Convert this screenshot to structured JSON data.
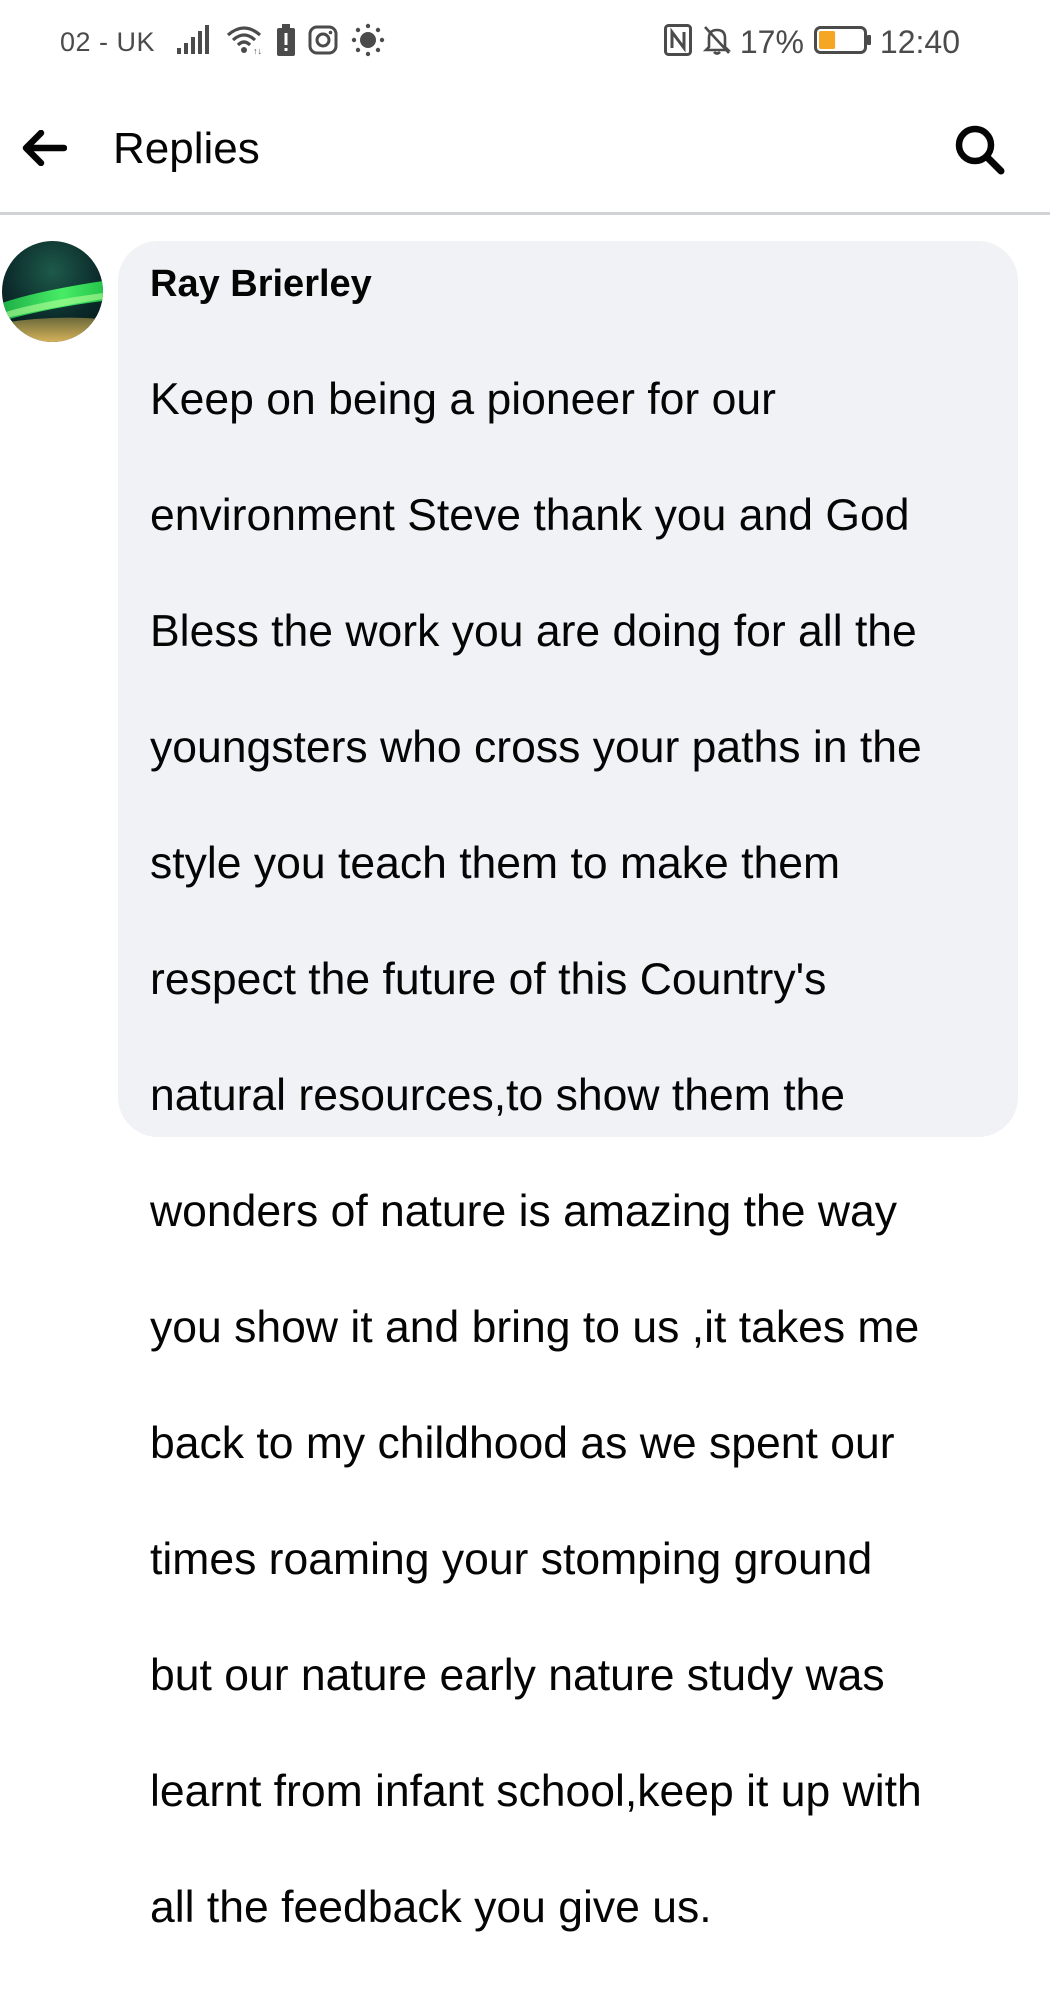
{
  "status_bar": {
    "carrier": "02 - UK",
    "battery_percent": "17%",
    "time": "12:40",
    "icons": [
      "signal-icon",
      "wifi-icon",
      "battery-alert-icon",
      "instagram-icon",
      "brightness-icon",
      "nfc-icon",
      "mute-bell-icon",
      "battery-icon"
    ],
    "battery_fill": 0.17,
    "battery_color": "#f5a623"
  },
  "header": {
    "title": "Replies",
    "back_icon": "back-arrow-icon",
    "search_icon": "search-icon"
  },
  "comment": {
    "author": "Ray Brierley",
    "avatar_icon": "aurora-avatar",
    "text_lines": [
      "Keep on being a pioneer for our",
      "environment Steve thank you and God",
      "Bless the work you are doing for all the",
      "youngsters who cross your paths in the",
      "style you teach them to make them",
      "respect the future of this Country's",
      "natural resources,to show them the",
      "wonders of nature is amazing the way",
      "you show it and bring to us ,it takes me",
      "back to my childhood as we spent our",
      "times roaming your stomping ground",
      "but our nature early nature study was",
      "learnt from infant school,keep it up with",
      "all the feedback you give us."
    ]
  },
  "colors": {
    "bubble_bg": "#f0f2f5",
    "text": "#050505",
    "status_text": "#4b4b4b",
    "divider": "#d2d3d6"
  }
}
